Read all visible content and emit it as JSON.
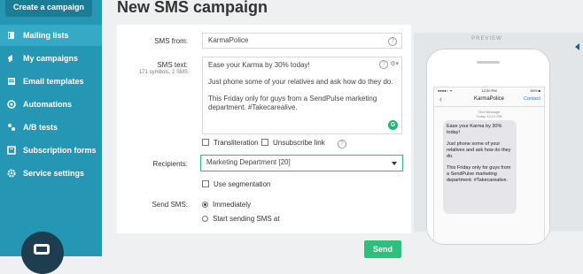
{
  "sidebar": {
    "create_label": "Create a campaign",
    "items": [
      {
        "label": "Mailing lists",
        "icon": "book-icon",
        "active": true
      },
      {
        "label": "My campaigns",
        "icon": "megaphone-icon",
        "active": false
      },
      {
        "label": "Email templates",
        "icon": "document-icon",
        "active": false
      },
      {
        "label": "Automations",
        "icon": "automation-icon",
        "active": false
      },
      {
        "label": "A/B tests",
        "icon": "split-icon",
        "active": false
      },
      {
        "label": "Subscription forms",
        "icon": "form-icon",
        "active": false
      },
      {
        "label": "Service settings",
        "icon": "gear-icon",
        "active": false
      }
    ]
  },
  "page": {
    "title": "New SMS campaign"
  },
  "form": {
    "from_label": "SMS from:",
    "from_value": "KarmaPolice",
    "text_label": "SMS text:",
    "text_counter": "171 symbols, 2 SMS",
    "text_paragraphs": [
      "Ease your Karma by 30% today!",
      "Just phone some of your relatives and ask how do they do.",
      "This Friday only for guys from a SendPulse marketing department. #Takecarealive."
    ],
    "translit_label": "Transliteration",
    "unsubscribe_label": "Unsubscribe link",
    "recipients_label": "Recipients:",
    "recipients_value": "Marketing Department [20]",
    "segmentation_label": "Use segmentation",
    "send_label": "Send SMS:",
    "send_options": [
      "Immediately",
      "Start sending SMS at"
    ],
    "send_selected": "Immediately",
    "send_button": "Send"
  },
  "preview": {
    "title": "PREVIEW",
    "status_time": "12:20 PM",
    "status_battery": "50% ■",
    "status_signal": "●●●●○ ᯤ",
    "contact_name": "KarmaPolice",
    "contact_link": "Contact",
    "back_glyph": "‹",
    "meta_line1": "Text Message",
    "meta_line2": "Today 12:21 PM",
    "bubble_paragraphs": [
      "Ease your Karma by 30% today!",
      "Just phone some of your relatives and ask how do they do.",
      "This Friday only for guys from a SendPulse marketing department. #Takecarealive."
    ]
  },
  "colors": {
    "sidebar": "#2596b4",
    "accent_green": "#2fbf7d",
    "link_blue": "#1f7bd8"
  }
}
